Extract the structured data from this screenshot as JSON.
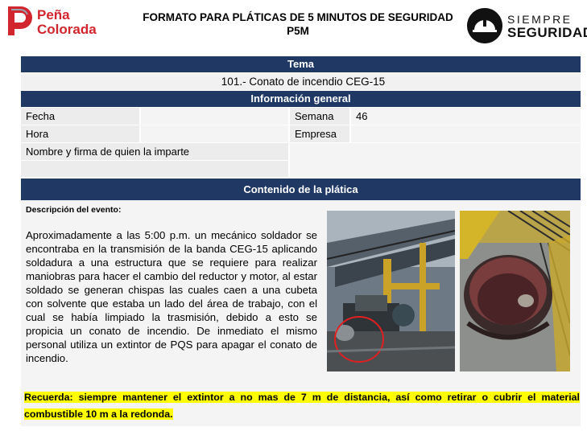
{
  "header": {
    "logo_left": [
      "Peña",
      "Colorada"
    ],
    "title_line1": "FORMATO PARA PLÁTICAS DE 5 MINUTOS DE SEGURIDAD",
    "title_line2": "P5M",
    "logo_right_line1": "SIEMPRE",
    "logo_right_line2": "SEGURIDAD"
  },
  "tema": {
    "heading": "Tema",
    "value": "101.- Conato de incendio CEG-15"
  },
  "info": {
    "heading": "Información general",
    "fecha_label": "Fecha",
    "fecha_value": "",
    "semana_label": "Semana",
    "semana_value": "46",
    "hora_label": "Hora",
    "hora_value": "",
    "empresa_label": "Empresa",
    "empresa_value": "",
    "firma_label": "Nombre y firma de quien la imparte"
  },
  "contenido": {
    "heading": "Contenido de la plática",
    "desc_label": "Descripción del evento:",
    "desc_text": "Aproximadamente a las 5:00 p.m. un mecánico soldador se encontraba en la transmisión de la banda CEG-15 aplicando soldadura a una estructura que se requiere para realizar maniobras para hacer el cambio del reductor y motor, al estar soldado se generan chispas las cuales caen a una cubeta con solvente que estaba un lado del área de trabajo, con el cual se había limpiado la trasmisión, debido a esto se propicia un conato de incendio. De inmediato el mismo personal utiliza un extintor de PQS para apagar el conato de incendio.",
    "recuerda": "Recuerda: siempre mantener el extintor a no mas de 7 m de distancia, así como retirar o cubrir el material combustible 10 m a la redonda."
  },
  "colors": {
    "band": "#1f3864",
    "brand_red": "#d2262e",
    "highlight": "#ffff00"
  }
}
